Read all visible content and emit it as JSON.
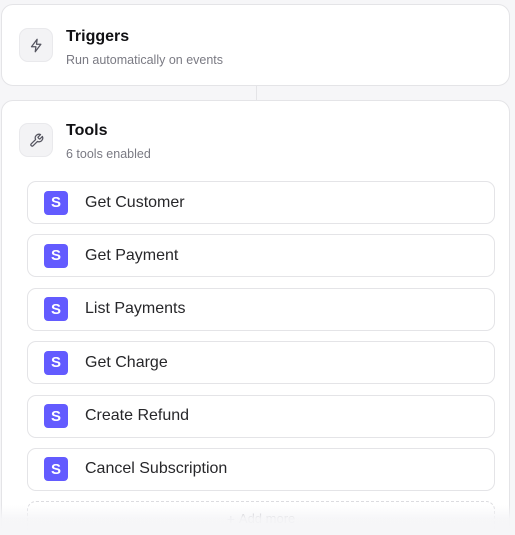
{
  "triggers": {
    "title": "Triggers",
    "subtitle": "Run automatically on events",
    "icon": "lightning-icon"
  },
  "tools": {
    "title": "Tools",
    "subtitle": "6 tools enabled",
    "icon": "wrench-icon",
    "logo_letter": "S",
    "logo_color": "#635bff",
    "items": [
      {
        "label": "Get Customer"
      },
      {
        "label": "Get Payment"
      },
      {
        "label": "List Payments"
      },
      {
        "label": "Get Charge"
      },
      {
        "label": "Create Refund"
      },
      {
        "label": "Cancel Subscription"
      }
    ],
    "add_more": "Add more"
  }
}
